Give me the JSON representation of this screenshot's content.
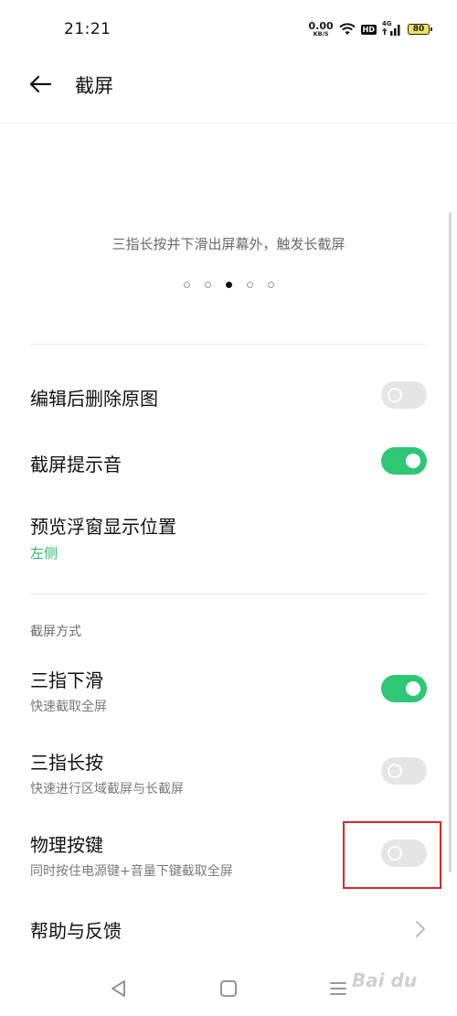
{
  "status_bar": {
    "time": "21:21",
    "net_speed_value": "0.00",
    "net_speed_unit": "KB/S",
    "hd_label": "HD",
    "network_type": "4G",
    "battery_level": "80",
    "icons": [
      "wifi-icon",
      "hd-icon",
      "signal-icon",
      "battery-icon"
    ]
  },
  "header": {
    "title": "截屏"
  },
  "illustration": {
    "caption": "三指长按并下滑出屏幕外，触发长截屏",
    "page_count": 5,
    "active_page": 3
  },
  "settings": {
    "delete_original": {
      "title": "编辑后删除原图",
      "enabled": false
    },
    "shutter_sound": {
      "title": "截屏提示音",
      "enabled": true
    },
    "preview_position": {
      "title": "预览浮窗显示位置",
      "value": "左侧"
    }
  },
  "methods_section": {
    "label": "截屏方式",
    "three_finger_swipe": {
      "title": "三指下滑",
      "subtitle": "快速截取全屏",
      "enabled": true
    },
    "three_finger_hold": {
      "title": "三指长按",
      "subtitle": "快速进行区域截屏与长截屏",
      "enabled": false
    },
    "physical_keys": {
      "title": "物理按键",
      "subtitle": "同时按住电源键+音量下键截取全屏",
      "enabled": false
    }
  },
  "help": {
    "title": "帮助与反馈"
  },
  "watermark": {
    "text": "Bai du"
  },
  "colors": {
    "accent_green": "#2fc675",
    "value_green": "#2db86c",
    "toggle_off": "#e5e5e5",
    "highlight_red": "#d9262e"
  }
}
